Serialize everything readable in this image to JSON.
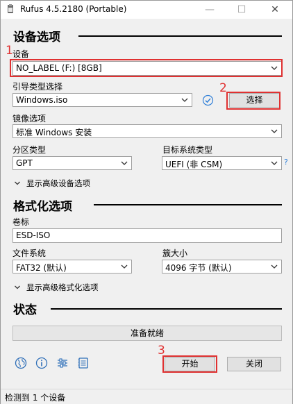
{
  "window": {
    "title": "Rufus 4.5.2180 (Portable)",
    "minimize_label": "—",
    "maximize_label": "☐",
    "close_label": "✕"
  },
  "drive_section": {
    "heading": "设备选项",
    "device_label": "设备",
    "device_value": "NO_LABEL (F:) [8GB]",
    "boot_label": "引导类型选择",
    "boot_value": "Windows.iso",
    "select_button": "选择",
    "image_option_label": "镜像选项",
    "image_option_value": "标准 Windows 安装",
    "partition_label": "分区类型",
    "partition_value": "GPT",
    "target_label": "目标系统类型",
    "target_value": "UEFI (非 CSM)",
    "help_mark": "?",
    "advanced_toggle": "显示高级设备选项"
  },
  "format_section": {
    "heading": "格式化选项",
    "volume_label": "卷标",
    "volume_value": "ESD-ISO",
    "filesystem_label": "文件系统",
    "filesystem_value": "FAT32 (默认)",
    "cluster_label": "簇大小",
    "cluster_value": "4096 字节 (默认)",
    "advanced_toggle": "显示高级格式化选项"
  },
  "status_section": {
    "heading": "状态",
    "progress_text": "准备就绪",
    "start_button": "开始",
    "close_button": "关闭"
  },
  "toolbar_icons": [
    "globe-icon",
    "info-icon",
    "settings-sliders-icon",
    "log-icon"
  ],
  "annotations": {
    "marker_1": "1",
    "marker_2": "2",
    "marker_3": "3",
    "color": "#e03131"
  },
  "statusbar": {
    "text": "检测到 1 个设备"
  }
}
